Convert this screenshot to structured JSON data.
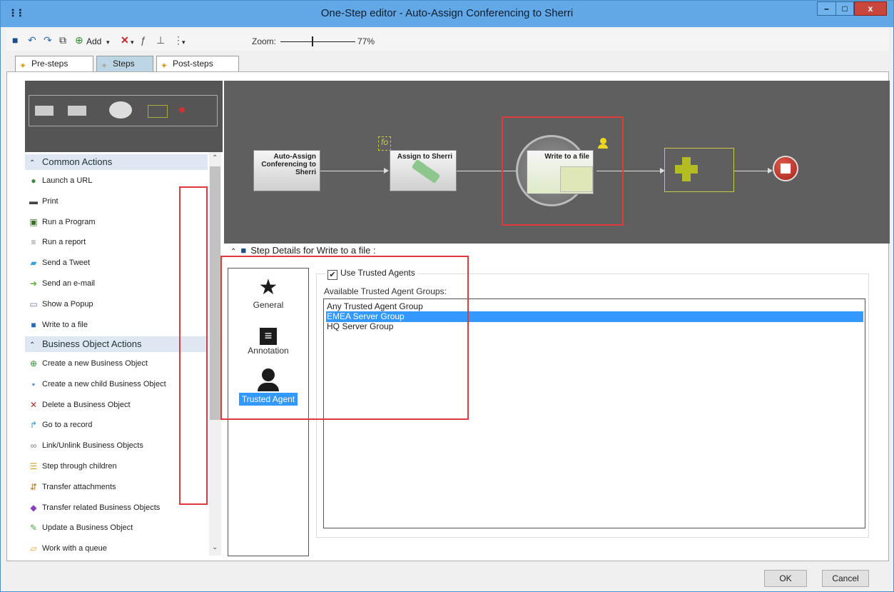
{
  "window": {
    "title": "One-Step editor - Auto-Assign Conferencing to Sherri",
    "minimize": "–",
    "maximize": "□",
    "close": "x"
  },
  "toolbar": {
    "add_label": "Add",
    "zoom_label": "Zoom:",
    "zoom_value": "77%",
    "zoom_level": 0.42
  },
  "tabs": [
    {
      "label": "Pre-steps",
      "active": false
    },
    {
      "label": "Steps",
      "active": true
    },
    {
      "label": "Post-steps",
      "active": false
    }
  ],
  "canvas": {
    "nodes": [
      {
        "label": "Auto-Assign Conferencing to Sherri"
      },
      {
        "label": "Assign to Sherri"
      },
      {
        "label": "Write to a file"
      }
    ],
    "fo_label": "fo"
  },
  "sidebar": {
    "common_header": "Common Actions",
    "common_items": [
      {
        "label": "Launch a URL",
        "icon": "globe-icon",
        "trusted": false
      },
      {
        "label": "Print",
        "icon": "printer-icon",
        "trusted": true
      },
      {
        "label": "Run a Program",
        "icon": "program-icon",
        "trusted": true
      },
      {
        "label": "Run a report",
        "icon": "report-icon",
        "trusted": true
      },
      {
        "label": "Send a Tweet",
        "icon": "tweet-icon",
        "trusted": false
      },
      {
        "label": "Send an e-mail",
        "icon": "email-icon",
        "trusted": false
      },
      {
        "label": "Show a Popup",
        "icon": "popup-icon",
        "trusted": false
      },
      {
        "label": "Write to a file",
        "icon": "save-icon",
        "trusted": true
      }
    ],
    "bo_header": "Business Object Actions",
    "bo_items": [
      {
        "label": "Create a new Business Object",
        "icon": "plus-circle-icon",
        "trusted": false
      },
      {
        "label": "Create a new child Business Object",
        "icon": "child-object-icon",
        "trusted": false
      },
      {
        "label": "Delete a Business Object",
        "icon": "delete-x-icon",
        "trusted": false
      },
      {
        "label": "Go to a record",
        "icon": "goto-arrow-icon",
        "trusted": false
      },
      {
        "label": "Link/Unlink Business Objects",
        "icon": "link-icon",
        "trusted": false
      },
      {
        "label": "Step through children",
        "icon": "step-children-icon",
        "trusted": false
      },
      {
        "label": "Transfer attachments",
        "icon": "attachment-icon",
        "trusted": true
      },
      {
        "label": "Transfer related Business Objects",
        "icon": "transfer-icon",
        "trusted": false
      },
      {
        "label": "Update a Business Object",
        "icon": "pencil-icon",
        "trusted": false
      },
      {
        "label": "Work with a queue",
        "icon": "queue-icon",
        "trusted": false
      }
    ]
  },
  "details": {
    "header": "Step Details for Write to a file :",
    "categories": [
      {
        "label": "General",
        "icon": "star-icon",
        "selected": false
      },
      {
        "label": "Annotation",
        "icon": "annotation-icon",
        "selected": false
      },
      {
        "label": "Trusted Agent",
        "icon": "agent-icon",
        "selected": true
      }
    ],
    "use_trusted_label": "Use Trusted Agents",
    "use_trusted_checked": true,
    "available_label": "Available Trusted Agent Groups:",
    "groups": [
      {
        "label": "Any Trusted Agent Group",
        "selected": false
      },
      {
        "label": "EMEA Server Group",
        "selected": true
      },
      {
        "label": "HQ Server Group",
        "selected": false
      }
    ]
  },
  "buttons": {
    "ok": "OK",
    "cancel": "Cancel"
  },
  "colors": {
    "titlebar": "#63a8e6",
    "selection": "#3399ff",
    "highlight_box": "#e0393e",
    "canvas_bg": "#5f5f5f"
  }
}
